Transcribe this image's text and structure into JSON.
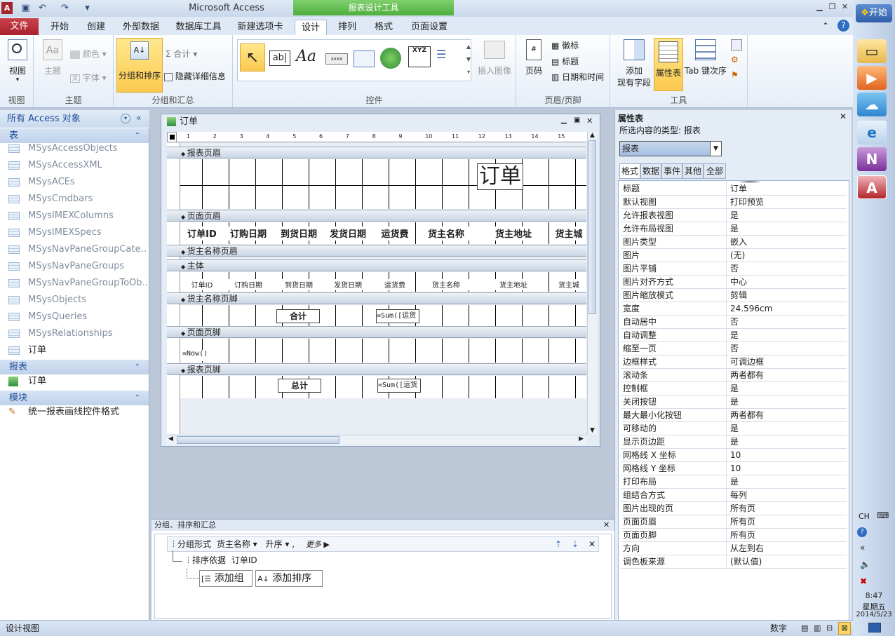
{
  "titlebar": {
    "app_title": "Microsoft Access",
    "context_title": "报表设计工具"
  },
  "tabs": [
    {
      "label": "文件"
    },
    {
      "label": "开始"
    },
    {
      "label": "创建"
    },
    {
      "label": "外部数据"
    },
    {
      "label": "数据库工具"
    },
    {
      "label": "新建选项卡"
    },
    {
      "label": "设计"
    },
    {
      "label": "排列"
    },
    {
      "label": "格式"
    },
    {
      "label": "页面设置"
    }
  ],
  "ribbon": {
    "view": {
      "label": "视图",
      "group": "视图"
    },
    "theme": {
      "theme": "主题",
      "colors": "颜色",
      "font": "字体",
      "group": "主题"
    },
    "grouping": {
      "group_sort": "分组和排序",
      "totals": "合计",
      "hide_details": "隐藏详细信息",
      "group": "分组和汇总"
    },
    "controls": {
      "group": "控件",
      "insert_image": "插入图像"
    },
    "header_footer": {
      "page_number": "页码",
      "logo": "徽标",
      "title": "标题",
      "datetime": "日期和时间",
      "group": "页眉/页脚"
    },
    "tools": {
      "add_fields_1": "添加",
      "add_fields_2": "现有字段",
      "property_sheet": "属性表",
      "tab_order": "Tab 键次序",
      "group": "工具"
    }
  },
  "nav": {
    "header": "所有 Access 对象",
    "sections": {
      "tables": "表",
      "reports": "报表",
      "modules": "模块"
    },
    "tables": [
      "MSysAccessObjects",
      "MSysAccessXML",
      "MSysACEs",
      "MSysCmdbars",
      "MSysIMEXColumns",
      "MSysIMEXSpecs",
      "MSysNavPaneGroupCate…",
      "MSysNavPaneGroups",
      "MSysNavPaneGroupToOb…",
      "MSysObjects",
      "MSysQueries",
      "MSysRelationships",
      "订单"
    ],
    "reports": [
      "订单"
    ],
    "modules": [
      "统一报表画线控件格式"
    ]
  },
  "report": {
    "caption": "订单",
    "ruler_numbers": [
      "1",
      "2",
      "3",
      "4",
      "5",
      "6",
      "7",
      "8",
      "9",
      "10",
      "11",
      "12",
      "13",
      "14",
      "15"
    ],
    "sections": {
      "report_header": "报表页眉",
      "page_header": "页面页眉",
      "group_header": "货主名称页眉",
      "detail": "主体",
      "group_footer": "货主名称页脚",
      "page_footer": "页面页脚",
      "report_footer": "报表页脚"
    },
    "title_label": "订单",
    "column_headers": [
      "订单ID",
      "订购日期",
      "到货日期",
      "发货日期",
      "运货费",
      "货主名称",
      "货主地址",
      "货主城"
    ],
    "detail_fields": [
      "订单ID",
      "订购日期",
      "到货日期",
      "发货日期",
      "运货费",
      "货主名称",
      "货主地址",
      "货主城"
    ],
    "group_total_label": "合计",
    "group_total_expr": "=Sum([运货",
    "page_footer_expr": "=Now()",
    "report_total_label": "总计",
    "report_total_expr": "=Sum([运货"
  },
  "group_pane": {
    "title": "分组、排序和汇总",
    "group_row": {
      "prefix": "分组形式",
      "field": "货主名称",
      "order": "升序",
      "more": "更多 ▶"
    },
    "sort_row": {
      "prefix": "排序依据",
      "field": "订单ID"
    },
    "add_group": "添加组",
    "add_sort": "添加排序"
  },
  "props": {
    "title": "属性表",
    "selection_type": "所选内容的类型: 报表",
    "combo_value": "报表",
    "tabs": [
      "格式",
      "数据",
      "事件",
      "其他",
      "全部"
    ],
    "rows": [
      {
        "k": "标题",
        "v": "订单"
      },
      {
        "k": "默认视图",
        "v": "打印预览"
      },
      {
        "k": "允许报表视图",
        "v": "是"
      },
      {
        "k": "允许布局视图",
        "v": "是"
      },
      {
        "k": "图片类型",
        "v": "嵌入"
      },
      {
        "k": "图片",
        "v": "(无)"
      },
      {
        "k": "图片平铺",
        "v": "否"
      },
      {
        "k": "图片对齐方式",
        "v": "中心"
      },
      {
        "k": "图片缩放模式",
        "v": "剪辑"
      },
      {
        "k": "宽度",
        "v": "24.596cm"
      },
      {
        "k": "自动居中",
        "v": "否"
      },
      {
        "k": "自动调整",
        "v": "是"
      },
      {
        "k": "缩至一页",
        "v": "否"
      },
      {
        "k": "边框样式",
        "v": "可调边框"
      },
      {
        "k": "滚动条",
        "v": "两者都有"
      },
      {
        "k": "控制框",
        "v": "是"
      },
      {
        "k": "关闭按钮",
        "v": "是"
      },
      {
        "k": "最大最小化按钮",
        "v": "两者都有"
      },
      {
        "k": "可移动的",
        "v": "是"
      },
      {
        "k": "显示页边距",
        "v": "是"
      },
      {
        "k": "网格线 X 坐标",
        "v": "10"
      },
      {
        "k": "网格线 Y 坐标",
        "v": "10"
      },
      {
        "k": "打印布局",
        "v": "是"
      },
      {
        "k": "组结合方式",
        "v": "每列"
      },
      {
        "k": "图片出现的页",
        "v": "所有页"
      },
      {
        "k": "页面页眉",
        "v": "所有页"
      },
      {
        "k": "页面页脚",
        "v": "所有页"
      },
      {
        "k": "方向",
        "v": "从左到右"
      },
      {
        "k": "调色板来源",
        "v": "(默认值)"
      }
    ]
  },
  "status": {
    "left": "设计视图",
    "num": "数字"
  },
  "taskbar": {
    "start": "开始",
    "lang": "CH",
    "time": "8:47",
    "weekday": "星期五",
    "date": "2014/5/23"
  }
}
